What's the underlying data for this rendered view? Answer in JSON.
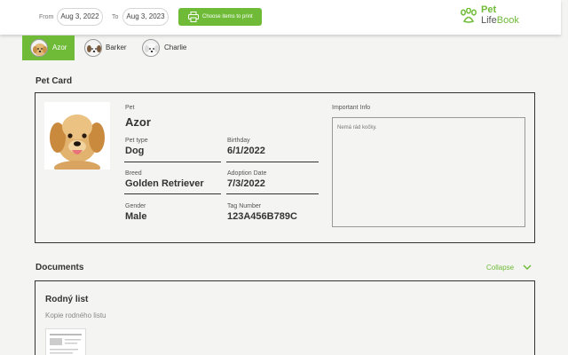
{
  "filters": {
    "from_label": "From",
    "from_date": "Aug 3, 2022",
    "to_label": "To",
    "to_date": "Aug 3, 2023",
    "print_button": "Choose items to print"
  },
  "logo": {
    "line1": "Pet",
    "line2_a": "Life",
    "line2_b": "Book"
  },
  "tabs": [
    {
      "name": "Azor",
      "active": true
    },
    {
      "name": "Barker",
      "active": false
    },
    {
      "name": "Charlie",
      "active": false
    }
  ],
  "pet_card": {
    "section_title": "Pet Card",
    "pet_label": "Pet",
    "pet_name": "Azor",
    "fields": {
      "pet_type": {
        "label": "Pet type",
        "value": "Dog"
      },
      "birthday": {
        "label": "Birthday",
        "value": "6/1/2022"
      },
      "breed": {
        "label": "Breed",
        "value": "Golden Retriever"
      },
      "adoption": {
        "label": "Adoption Date",
        "value": "7/3/2022"
      },
      "gender": {
        "label": "Gender",
        "value": "Male"
      },
      "tag": {
        "label": "Tag Number",
        "value": "123A456B789C"
      }
    },
    "important_info_label": "Important Info",
    "important_info_text": "Nemá rád kočky."
  },
  "documents": {
    "section_title": "Documents",
    "collapse_label": "Collapse",
    "items": [
      {
        "title": "Rodný list",
        "subtitle": "Kopie rodného listu"
      }
    ]
  },
  "colors": {
    "accent": "#6fbb38",
    "border": "#333333",
    "background": "#f4f4f2"
  }
}
